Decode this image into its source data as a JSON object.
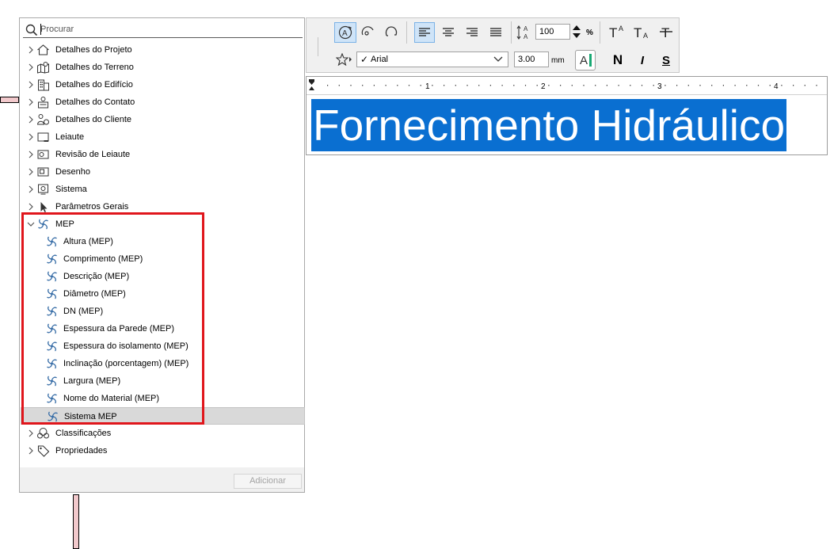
{
  "search": {
    "placeholder": "Procurar"
  },
  "tree": {
    "top_before": [
      {
        "label": "Detalhes do Projeto",
        "icon": "house-icon"
      },
      {
        "label": "Detalhes do Terreno",
        "icon": "map-pin-icon"
      },
      {
        "label": "Detalhes do Edifício",
        "icon": "building-icon"
      },
      {
        "label": "Detalhes do Contato",
        "icon": "contact-icon"
      },
      {
        "label": "Detalhes do Cliente",
        "icon": "client-icon"
      },
      {
        "label": "Leiaute",
        "icon": "layout-icon"
      },
      {
        "label": "Revisão de Leiaute",
        "icon": "layout-revision-icon"
      },
      {
        "label": "Desenho",
        "icon": "drawing-icon"
      },
      {
        "label": "Sistema",
        "icon": "system-icon"
      },
      {
        "label": "Parâmetros Gerais",
        "icon": "cursor-icon"
      }
    ],
    "mep": {
      "label": "MEP",
      "icon": "mep-icon",
      "children": [
        {
          "label": "Altura (MEP)"
        },
        {
          "label": "Comprimento (MEP)"
        },
        {
          "label": "Descrição (MEP)"
        },
        {
          "label": "Diâmetro (MEP)"
        },
        {
          "label": "DN (MEP)"
        },
        {
          "label": "Espessura da Parede (MEP)"
        },
        {
          "label": "Espessura do isolamento (MEP)"
        },
        {
          "label": "Inclinação (porcentagem) (MEP)"
        },
        {
          "label": "Largura (MEP)"
        },
        {
          "label": "Nome do Material (MEP)"
        },
        {
          "label": "Sistema MEP"
        }
      ],
      "selected": "Sistema MEP"
    },
    "top_after": [
      {
        "label": "Classificações",
        "icon": "classification-icon"
      },
      {
        "label": "Propriedades",
        "icon": "tag-icon"
      }
    ]
  },
  "footer": {
    "add_label": "Adicionar"
  },
  "toolbar": {
    "line_spacing_value": "100",
    "line_spacing_unit": "%",
    "font_name": "Arial",
    "font_size_value": "3.00",
    "font_size_unit": "mm",
    "color_letter": "A",
    "bold_label": "N",
    "italic_label": "I",
    "underline_label": "S"
  },
  "ruler": {
    "labels": [
      "1",
      "2",
      "3",
      "4"
    ]
  },
  "text_frame": {
    "content": "Fornecimento Hidráulico"
  },
  "colors": {
    "highlight": "#e0161c",
    "selection": "#0a6fd1",
    "active_button": "#cfe4f8",
    "accent_green": "#19a974"
  }
}
